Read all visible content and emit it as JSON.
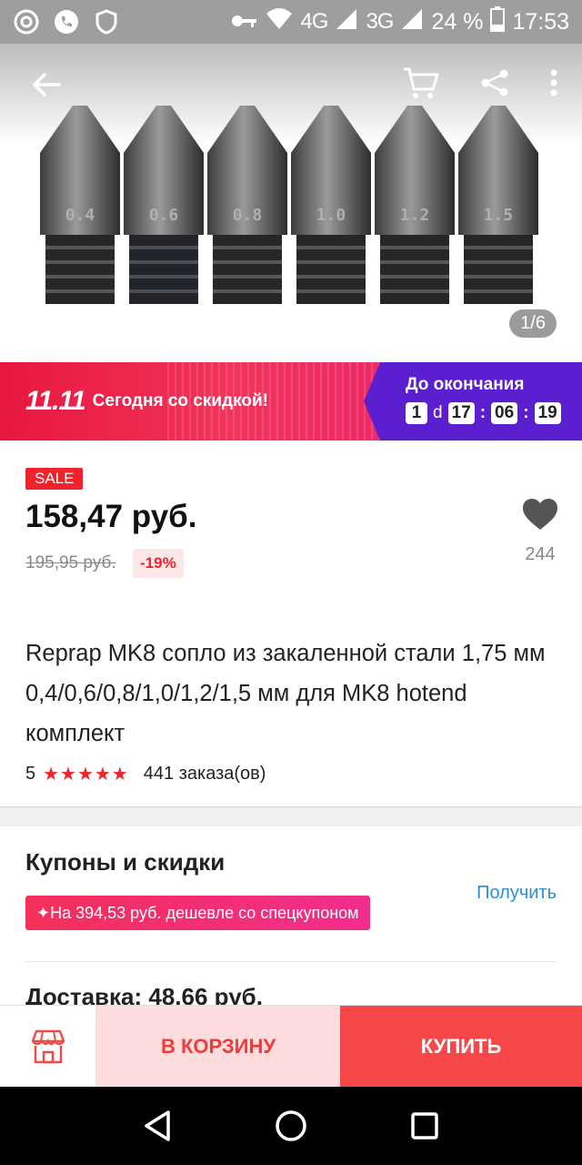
{
  "status_bar": {
    "network_4g": "4G",
    "network_3g": "3G",
    "battery": "24 %",
    "time": "17:53"
  },
  "gallery": {
    "nozzle_labels": [
      "0.4",
      "0.6",
      "0.8",
      "1.0",
      "1.2",
      "1.5"
    ],
    "counter": "1/6"
  },
  "promo": {
    "event": "11.11",
    "text": "Сегодня со скидкой!",
    "until_label": "До окончания",
    "days": "1",
    "days_unit": "d",
    "hours": "17",
    "minutes": "06",
    "seconds": "19"
  },
  "price": {
    "badge": "SALE",
    "current": "158,47 руб.",
    "old": "195,95 руб.",
    "discount": "-19%"
  },
  "wishlist": {
    "count": "244"
  },
  "product": {
    "title": "Reprap MK8 сопло из закаленной стали 1,75 мм 0,4/0,6/0,8/1,0/1,2/1,5 мм для MK8 hotend комплект",
    "rating": "5",
    "stars": "★★★★★",
    "orders": "441 заказа(ов)"
  },
  "coupons": {
    "title": "Купоны и скидки",
    "get_label": "Получить",
    "coupon_text": "✦На 394,53 руб. дешевле со спецкупоном"
  },
  "delivery": {
    "label": "Доставка: 48,66 руб."
  },
  "actions": {
    "cart_label": "В КОРЗИНУ",
    "buy_label": "КУПИТЬ"
  },
  "colors": {
    "accent_red": "#f0232d",
    "promo_purple": "#5b1fcf",
    "link_blue": "#2b8fd8"
  }
}
